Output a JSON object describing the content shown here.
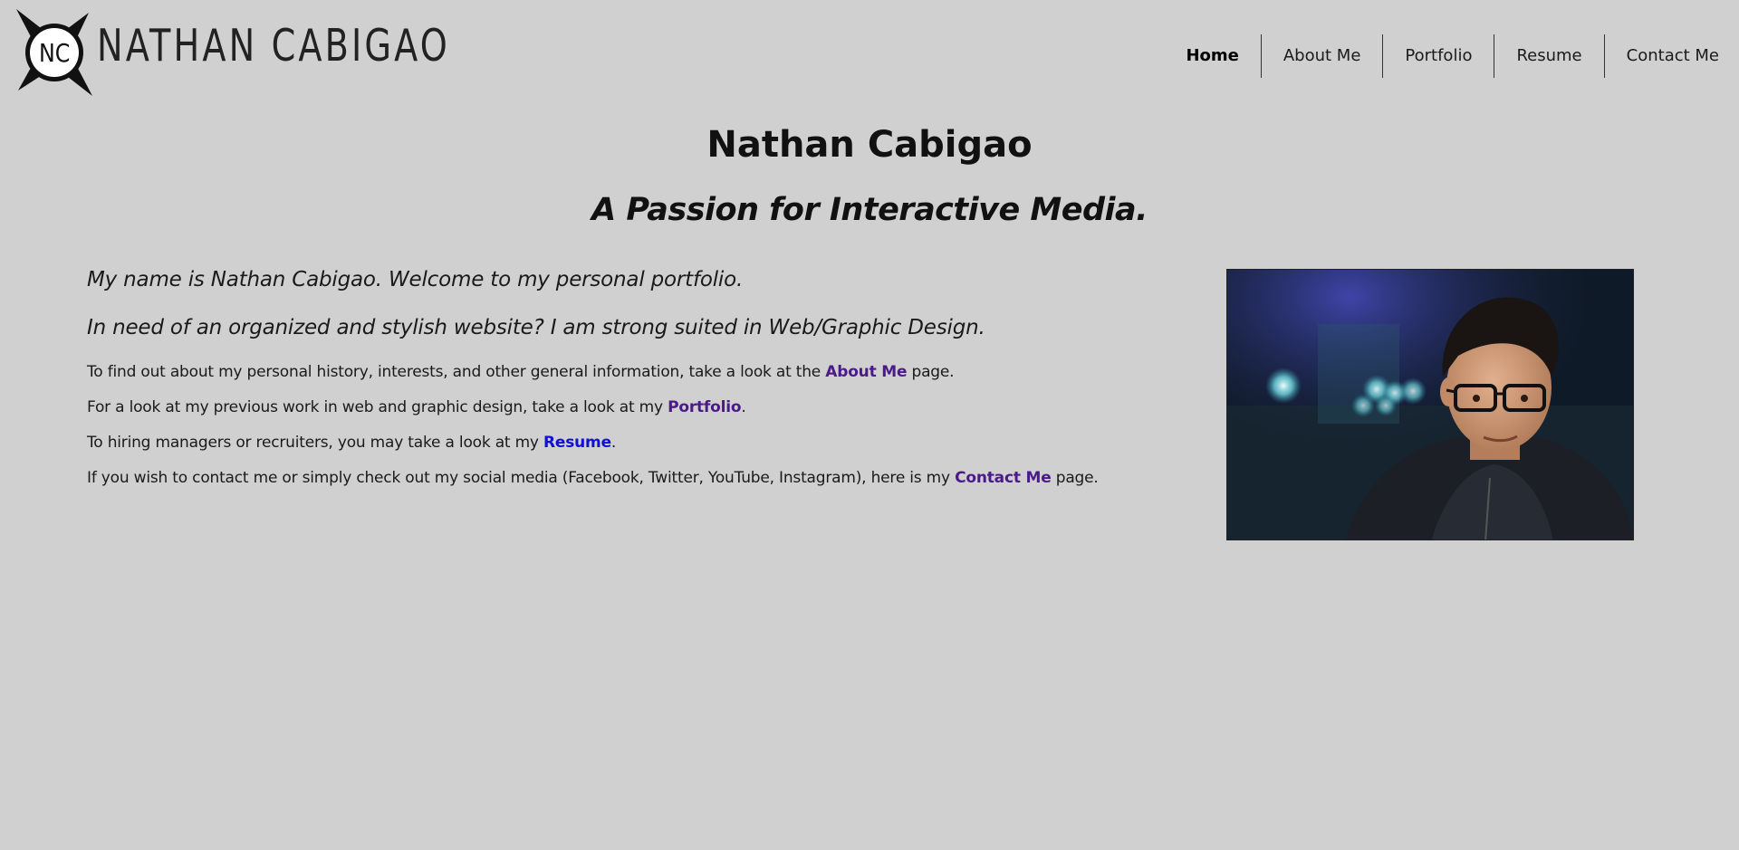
{
  "header": {
    "logo_letters": "NC",
    "site_title": "NATHAN CABIGAO"
  },
  "nav": {
    "items": [
      {
        "label": "Home",
        "active": true
      },
      {
        "label": "About Me",
        "active": false
      },
      {
        "label": "Portfolio",
        "active": false
      },
      {
        "label": "Resume",
        "active": false
      },
      {
        "label": "Contact Me",
        "active": false
      }
    ]
  },
  "main": {
    "title": "Nathan Cabigao",
    "tagline": "A Passion for Interactive Media.",
    "intro_1": "My name is Nathan Cabigao. Welcome to my personal portfolio.",
    "intro_2": "In need of an organized and stylish website? I am strong suited in Web/Graphic Design.",
    "para_about": {
      "before": "To find out about my personal history, interests, and other general information, take a look at the ",
      "link": "About Me",
      "after": " page."
    },
    "para_portfolio": {
      "before": "For a look at my previous work in web and graphic design, take a look at my ",
      "link": "Portfolio",
      "after": "."
    },
    "para_resume": {
      "before": "To hiring managers or recruiters, you may take a look at my ",
      "link": "Resume",
      "after": "."
    },
    "para_contact": {
      "before": "If you wish to contact me or simply check out my social media (Facebook, Twitter, YouTube, Instagram), here is my ",
      "link": "Contact Me",
      "after": " page."
    }
  },
  "photo": {
    "alt": "portrait-photo"
  },
  "colors": {
    "background": "#d0d0d0",
    "text": "#111111",
    "link_visited": "#4b1a8a",
    "link_unvisited": "#1010d0"
  }
}
